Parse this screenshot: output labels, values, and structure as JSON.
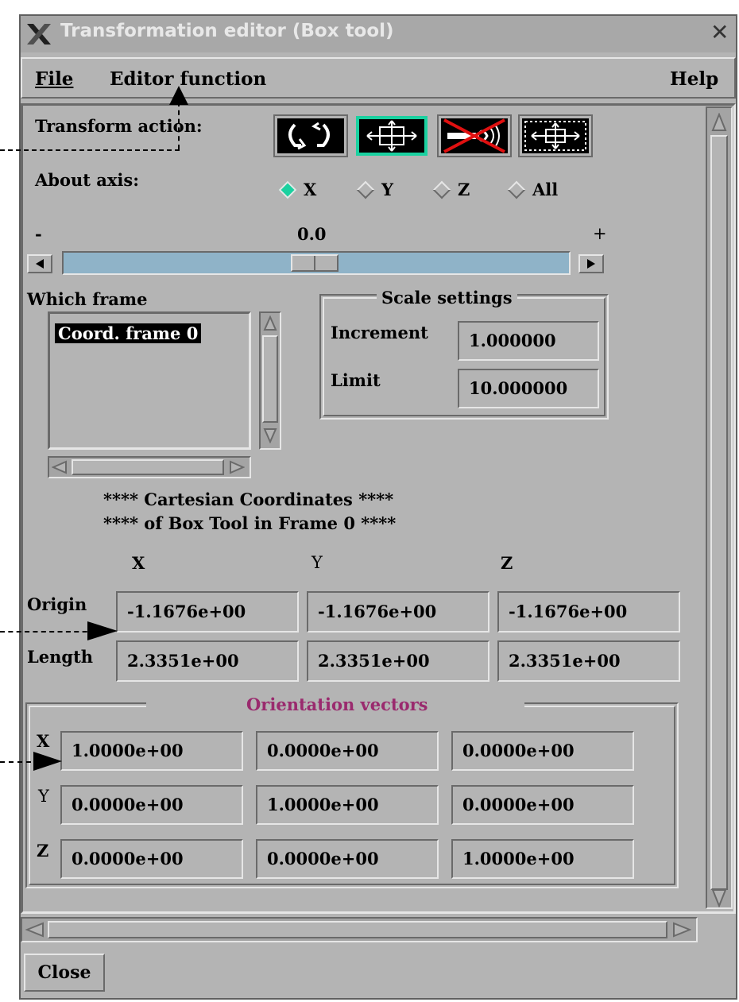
{
  "window": {
    "title": "Transformation editor (Box tool)",
    "close_glyph": "✕"
  },
  "menubar": {
    "file": "File",
    "editor_function": "Editor function",
    "help": "Help"
  },
  "transform": {
    "label": "Transform action:",
    "actions": [
      "rotate",
      "translate",
      "disabled-action",
      "scale"
    ]
  },
  "axis": {
    "label": "About axis:",
    "options": [
      "X",
      "Y",
      "Z",
      "All"
    ],
    "selected": "X"
  },
  "slider": {
    "minus": "-",
    "value_text": "0.0",
    "plus": "+",
    "position_fraction": 0.5
  },
  "frame": {
    "label": "Which frame",
    "items": [
      "Coord. frame 0"
    ]
  },
  "scale": {
    "title": "Scale settings",
    "increment_label": "Increment",
    "increment": "1.000000",
    "limit_label": "Limit",
    "limit": "10.000000"
  },
  "coords": {
    "heading1": "**** Cartesian Coordinates ****",
    "heading2": "**** of Box Tool in Frame 0 ****",
    "col_x": "X",
    "col_y": "Y",
    "col_z": "Z",
    "origin_label": "Origin",
    "origin": [
      "-1.1676e+00",
      "-1.1676e+00",
      "-1.1676e+00"
    ],
    "length_label": "Length",
    "length": [
      "2.3351e+00",
      "2.3351e+00",
      "2.3351e+00"
    ]
  },
  "orientation": {
    "title": "Orientation vectors",
    "row_x_label": "X",
    "row_x": [
      "1.0000e+00",
      "0.0000e+00",
      "0.0000e+00"
    ],
    "row_y_label": "Y",
    "row_y": [
      "0.0000e+00",
      "1.0000e+00",
      "0.0000e+00"
    ],
    "row_z_label": "Z",
    "row_z": [
      "0.0000e+00",
      "0.0000e+00",
      "1.0000e+00"
    ]
  },
  "footer": {
    "close": "Close"
  },
  "colors": {
    "panel": "#b4b4b4",
    "title_bar": "#a8a8a8",
    "accent_green": "#1ad1a0",
    "orientation_title": "#9a2a6e",
    "slider_trough": "#8fb3c8"
  }
}
